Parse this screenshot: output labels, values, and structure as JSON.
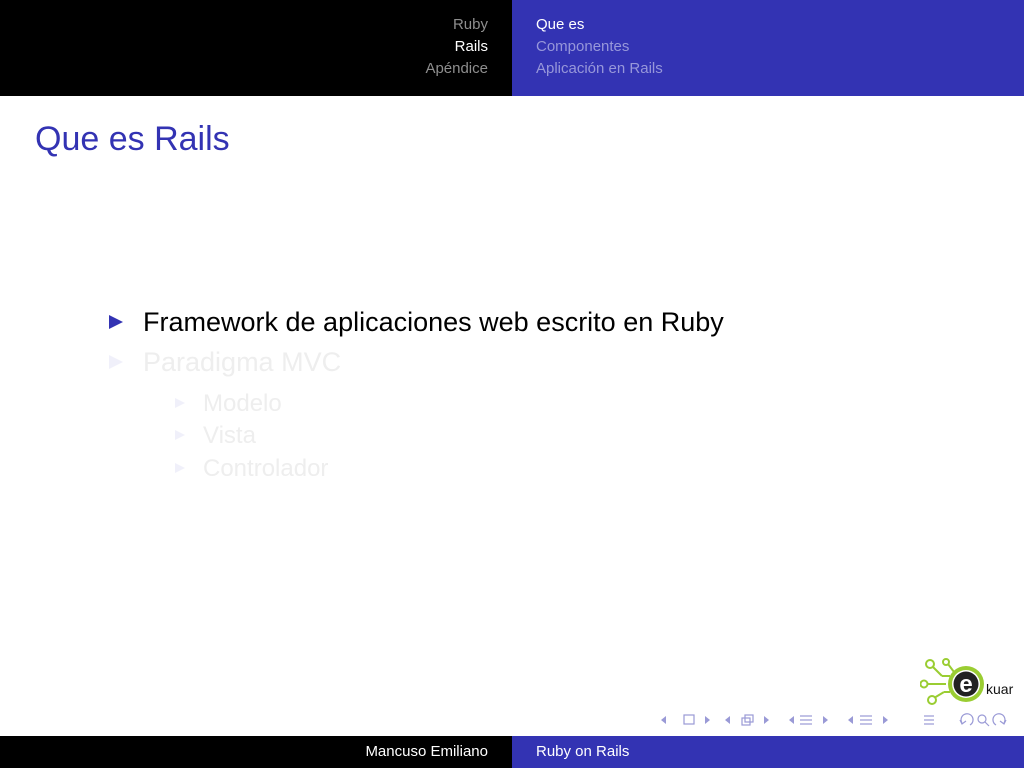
{
  "header": {
    "sections": [
      {
        "label": "Ruby",
        "state": "inactive"
      },
      {
        "label": "Rails",
        "state": "active"
      },
      {
        "label": "Apéndice",
        "state": "inactive"
      }
    ],
    "subsections": [
      {
        "label": "Que es",
        "state": "active"
      },
      {
        "label": "Componentes",
        "state": "inactive"
      },
      {
        "label": "Aplicación en Rails",
        "state": "inactive"
      }
    ]
  },
  "frame": {
    "title": "Que es Rails",
    "bullets": [
      {
        "text": "Framework de aplicaciones web escrito en Ruby",
        "level": 1,
        "visible": true
      },
      {
        "text": "Paradigma MVC",
        "level": 1,
        "visible": false
      },
      {
        "text": "Modelo",
        "level": 2,
        "visible": false
      },
      {
        "text": "Vista",
        "level": 2,
        "visible": false
      },
      {
        "text": "Controlador",
        "level": 2,
        "visible": false
      }
    ]
  },
  "logo": {
    "text": "kuar",
    "letter": "e"
  },
  "footer": {
    "author": "Mancuso Emiliano",
    "title": "Ruby on Rails"
  },
  "colors": {
    "accent": "#3333b3",
    "header_left": "#000000",
    "text": "#000000",
    "logo_green": "#9acd32"
  },
  "icons": [
    "bullet-triangle-icon",
    "ekuar-logo",
    "beamer-nav-icons"
  ]
}
